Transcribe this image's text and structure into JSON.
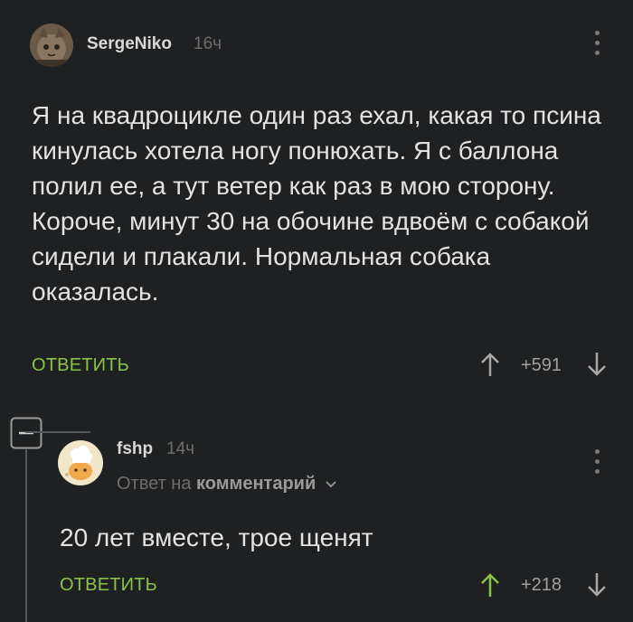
{
  "comment": {
    "username": "SergeNiko",
    "time": "16ч",
    "text": "Я на квадроцикле один раз ехал, какая то псина кинулась хотела ногу понюхать. Я с баллона полил ее, а тут ветер как раз в мою сторону. Короче, минут 30 на обочине вдвоём с собакой сидели и плакали. Нормальная собака оказалась.",
    "reply_label": "ОТВЕТИТЬ",
    "rating": "+591"
  },
  "reply": {
    "username": "fshp",
    "time": "14ч",
    "reply_to_prefix": "Ответ на",
    "reply_to_target": "комментарий",
    "text": "20 лет вместе, трое щенят",
    "reply_label": "ОТВЕТИТЬ",
    "rating": "+218"
  },
  "icons": {
    "collapse": "minus-box-icon",
    "upvote": "arrow-up-icon",
    "downvote": "arrow-down-icon",
    "menu": "more-vertical-icon",
    "chevron": "chevron-down-icon"
  },
  "colors": {
    "background": "#1e2022",
    "accent_green": "#8bc34a",
    "upvote_active": "#8bc34a"
  }
}
